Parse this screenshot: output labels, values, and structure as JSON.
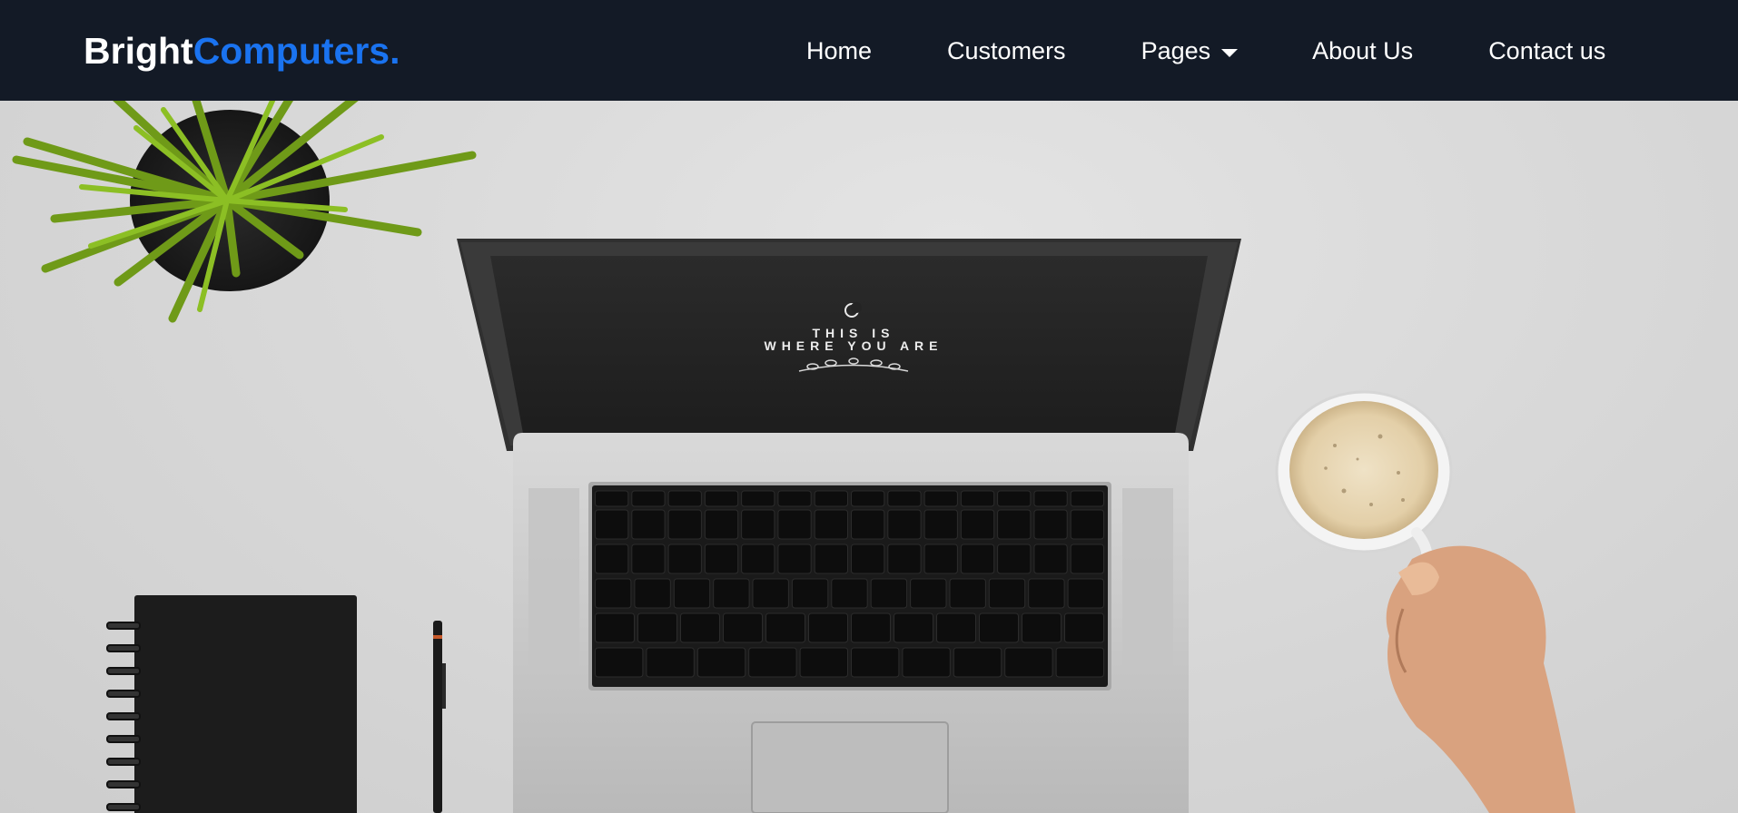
{
  "brand": {
    "part1": "Bright",
    "part2": "Computers."
  },
  "nav": {
    "items": [
      {
        "label": "Home"
      },
      {
        "label": "Customers"
      },
      {
        "label": "Pages"
      },
      {
        "label": "About Us"
      },
      {
        "label": "Contact us"
      }
    ]
  },
  "hero": {
    "screen_line1": "THIS IS",
    "screen_line2": "WHERE YOU ARE"
  },
  "colors": {
    "navbar_bg": "#131a26",
    "brand_accent": "#1a73f0",
    "nav_text": "#ffffff"
  },
  "icons": {
    "pages_dropdown": "caret-down"
  }
}
